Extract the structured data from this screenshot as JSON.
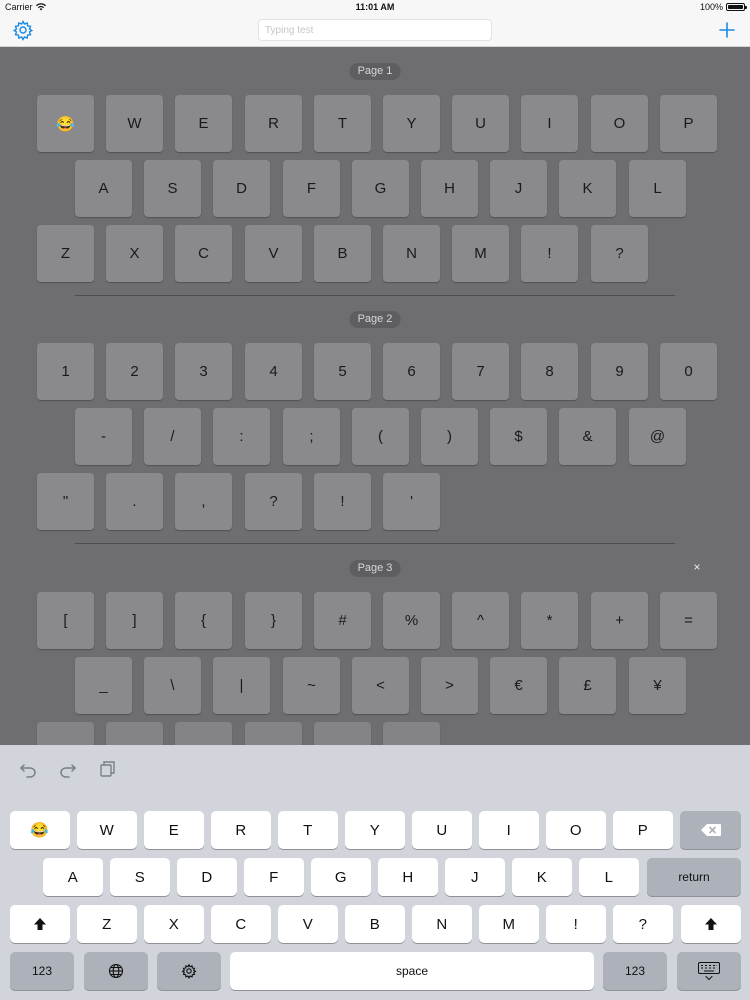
{
  "status_bar": {
    "carrier": "Carrier",
    "time": "11:01 AM",
    "battery": "100%"
  },
  "navbar": {
    "settings_icon": "gear-icon",
    "search_placeholder": "Typing test",
    "search_value": "",
    "add_icon": "plus-icon"
  },
  "colors": {
    "accent": "#1a8ae6",
    "dim_background": "#6e6e72",
    "keyboard_background": "#d1d4da"
  },
  "grid": {
    "pages": [
      {
        "label": "Page 1",
        "rows": [
          [
            "😂",
            "W",
            "E",
            "R",
            "T",
            "Y",
            "U",
            "I",
            "O",
            "P"
          ],
          [
            "A",
            "S",
            "D",
            "F",
            "G",
            "H",
            "J",
            "K",
            "L"
          ],
          [
            "Z",
            "X",
            "C",
            "V",
            "B",
            "N",
            "M",
            "!",
            "?"
          ]
        ]
      },
      {
        "label": "Page 2",
        "rows": [
          [
            "1",
            "2",
            "3",
            "4",
            "5",
            "6",
            "7",
            "8",
            "9",
            "0"
          ],
          [
            "-",
            "/",
            ":",
            ";",
            "(",
            ")",
            "$",
            "&",
            "@"
          ],
          [
            "\"",
            ".",
            ",",
            "?",
            "!",
            "'"
          ]
        ]
      },
      {
        "label": "Page 3",
        "close": "×",
        "rows": [
          [
            "[",
            "]",
            "{",
            "}",
            "#",
            "%",
            "^",
            "*",
            "+",
            "="
          ],
          [
            "_",
            "\\",
            "|",
            "~",
            "<",
            ">",
            "€",
            "£",
            "¥"
          ],
          [
            "",
            "",
            "",
            "",
            "",
            ""
          ]
        ]
      }
    ]
  },
  "keyboard": {
    "shortcut_icons": [
      "undo-icon",
      "redo-icon",
      "paste-icon"
    ],
    "row1": [
      "😂",
      "W",
      "E",
      "R",
      "T",
      "Y",
      "U",
      "I",
      "O",
      "P"
    ],
    "row1_delete_icon": "backspace-icon",
    "row2": [
      "A",
      "S",
      "D",
      "F",
      "G",
      "H",
      "J",
      "K",
      "L"
    ],
    "row2_return": "return",
    "row3_shift_icon": "shift-icon",
    "row3": [
      "Z",
      "X",
      "C",
      "V",
      "B",
      "N",
      "M",
      "!",
      "?"
    ],
    "row4": {
      "numbers_left": "123",
      "globe_icon": "globe-icon",
      "gear_icon": "gear-icon",
      "space": "space",
      "numbers_right": "123",
      "dismiss_icon": "keyboard-dismiss-icon"
    }
  }
}
